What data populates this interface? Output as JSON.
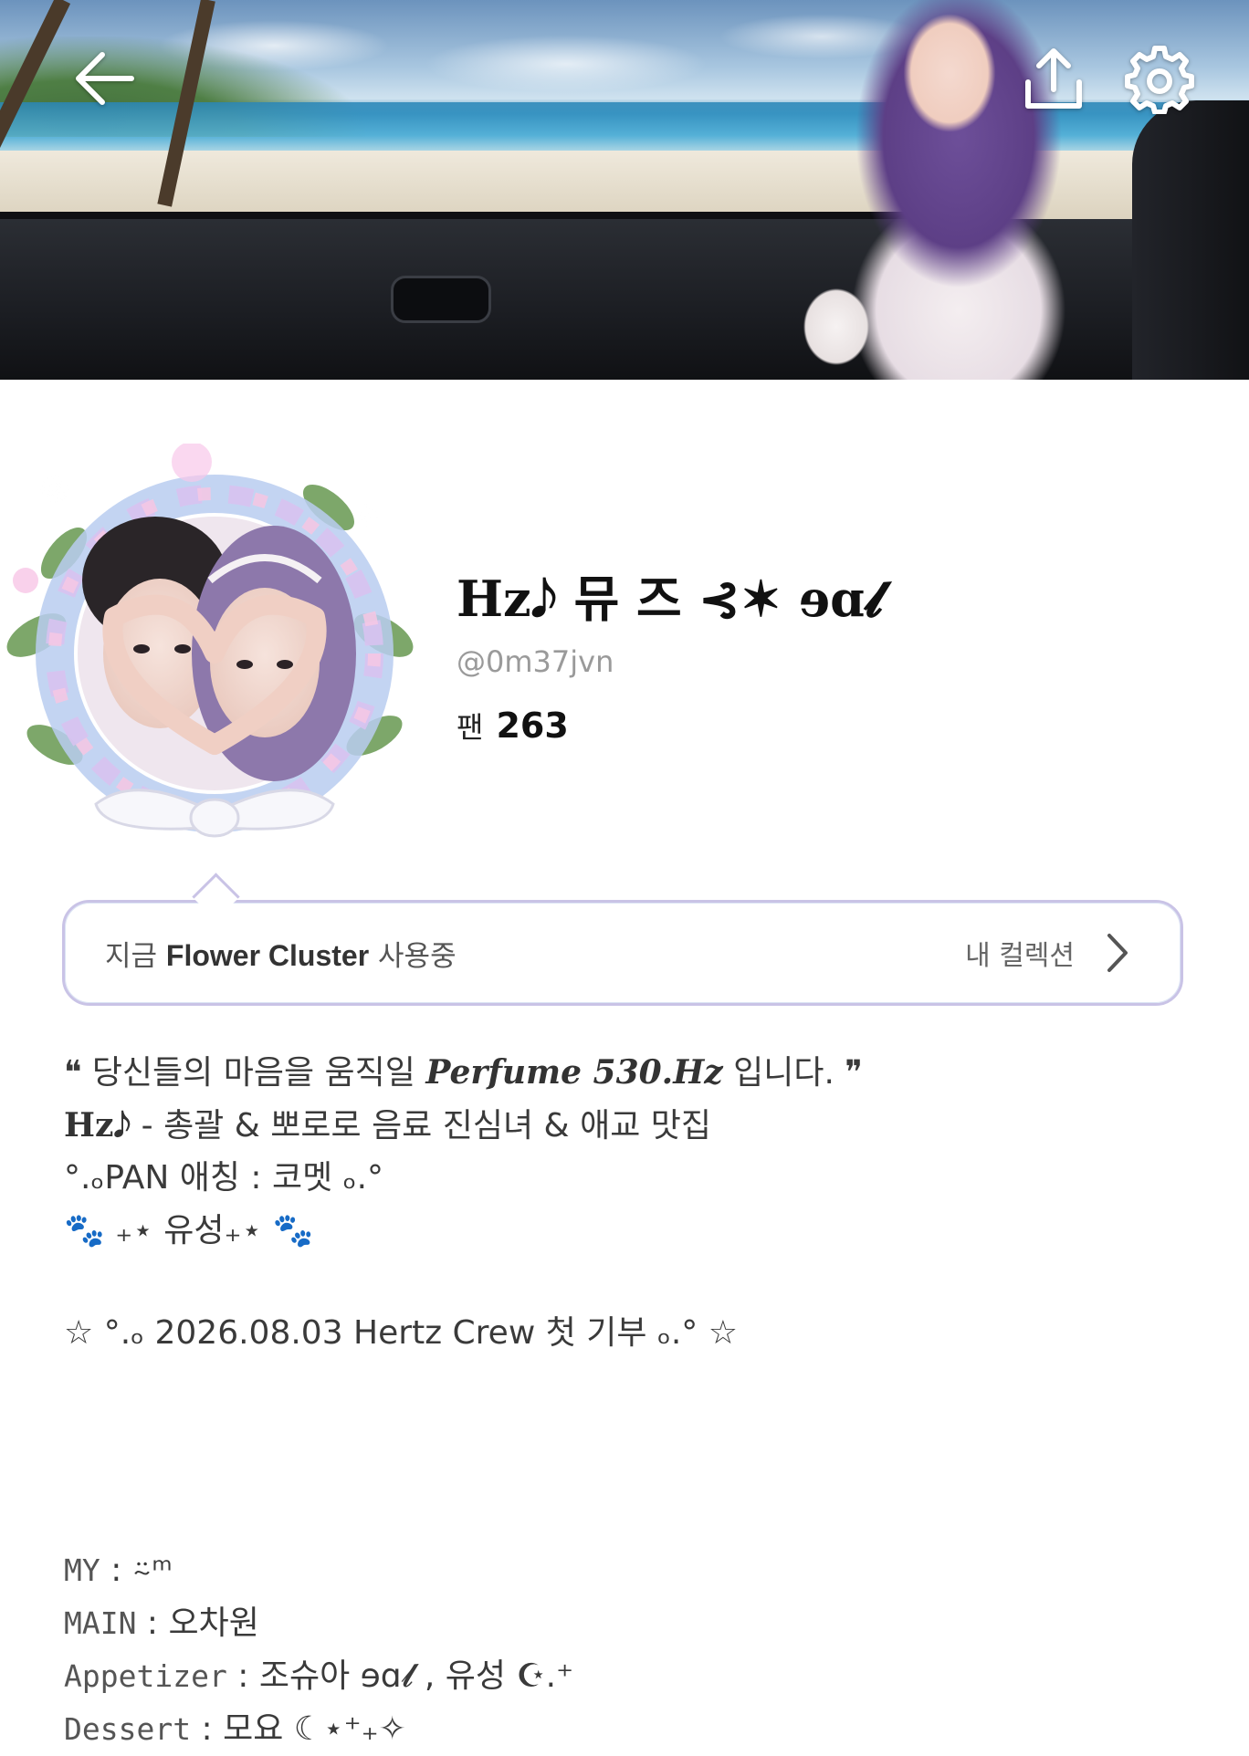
{
  "header": {
    "back_icon": "arrow-left-icon",
    "share_icon": "share-upload-icon",
    "settings_icon": "gear-icon"
  },
  "profile": {
    "name": "Hz𝅘𝅥𝅮 뮤 즈 ⊰✶ ɘɑ𝓵",
    "handle": "@0m37jvn",
    "fans_label": "팬",
    "fans_count": "263"
  },
  "collection": {
    "prefix": "지금 ",
    "item": "Flower Cluster",
    "suffix": " 사용중",
    "link_label": "내 컬렉션"
  },
  "bio": {
    "line1_open": "❝ 당신들의 마음을 움직일 ",
    "line1_em": "Perfume 530.Hz",
    "line1_close": " 입니다. ❞",
    "line2_em": "Hz𝅘𝅥𝅮",
    "line2_rest": " - 총괄 & 뽀로로 음료 진심녀 & 애교 맛집",
    "line3": "°.ₒPAN 애칭 : 코멧 ₒ.°",
    "line4_paw_left": "🐾",
    "line4_text": "₊⋆ 유성₊⋆",
    "line4_paw_right": "🐾",
    "line5": "☆ °.ₒ 2026.08.03 Hertz Crew 첫 기부 ₒ.° ☆",
    "my_label": "MY",
    "my_value": " : ⍨ᵐ",
    "main_label": "MAIN",
    "main_value": " : 오차원",
    "appetizer_label": "Appetizer",
    "appetizer_value": " : 조슈아 ɘɑ𝓵 , 유성 ☪.⁺",
    "dessert_label": "Dessert",
    "dessert_value": " : 모요 ☾⋆⁺₊✧"
  }
}
